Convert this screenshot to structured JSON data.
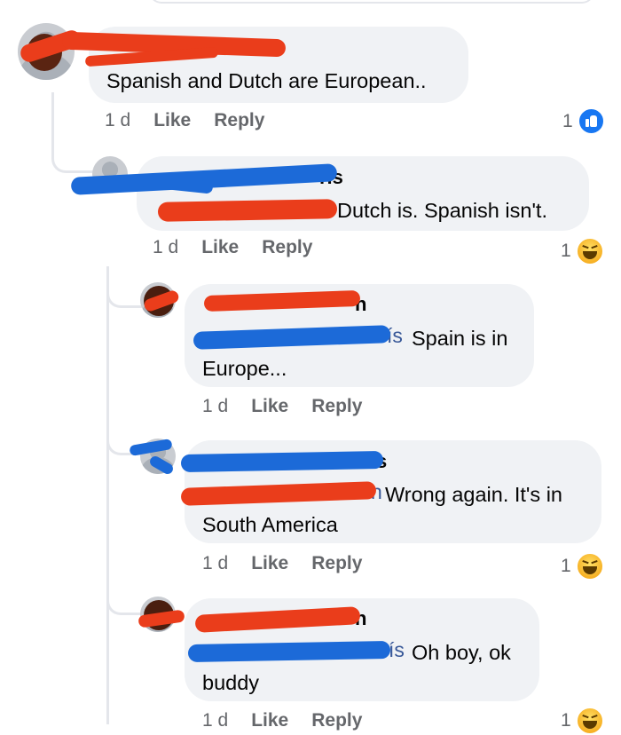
{
  "comments": [
    {
      "id": "c1",
      "text": "Spanish and Dutch are European..",
      "age": "1 d",
      "like_label": "Like",
      "reply_label": "Reply",
      "reaction_count": "1",
      "reaction_type": "like-icon"
    },
    {
      "id": "c2",
      "name_fragment": "ris",
      "text": "Dutch is. Spanish isn't.",
      "age": "1 d",
      "like_label": "Like",
      "reply_label": "Reply",
      "reaction_count": "1",
      "reaction_type": "haha-icon"
    },
    {
      "id": "c3",
      "name_fragment": "n",
      "mention_fragment": "ís",
      "text_line1": "Spain is in",
      "text_line2": "Europe...",
      "age": "1 d",
      "like_label": "Like",
      "reply_label": "Reply"
    },
    {
      "id": "c4",
      "name_fragment": "s",
      "mention_fragment": "n",
      "text_line1": "Wrong again. It's in",
      "text_line2": "South America",
      "age": "1 d",
      "like_label": "Like",
      "reply_label": "Reply",
      "reaction_count": "1",
      "reaction_type": "haha-icon"
    },
    {
      "id": "c5",
      "name_fragment": "n",
      "mention_fragment": "ís",
      "text_line1": "Oh boy, ok",
      "text_line2": "buddy",
      "age": "1 d",
      "like_label": "Like",
      "reply_label": "Reply",
      "reaction_count": "1",
      "reaction_type": "haha-icon"
    }
  ],
  "colors": {
    "bubble": "#f0f2f5",
    "meta_text": "#65676b",
    "like_blue": "#1877f2",
    "redaction_red": "#ea3d1b",
    "redaction_blue": "#1c6ad8"
  }
}
